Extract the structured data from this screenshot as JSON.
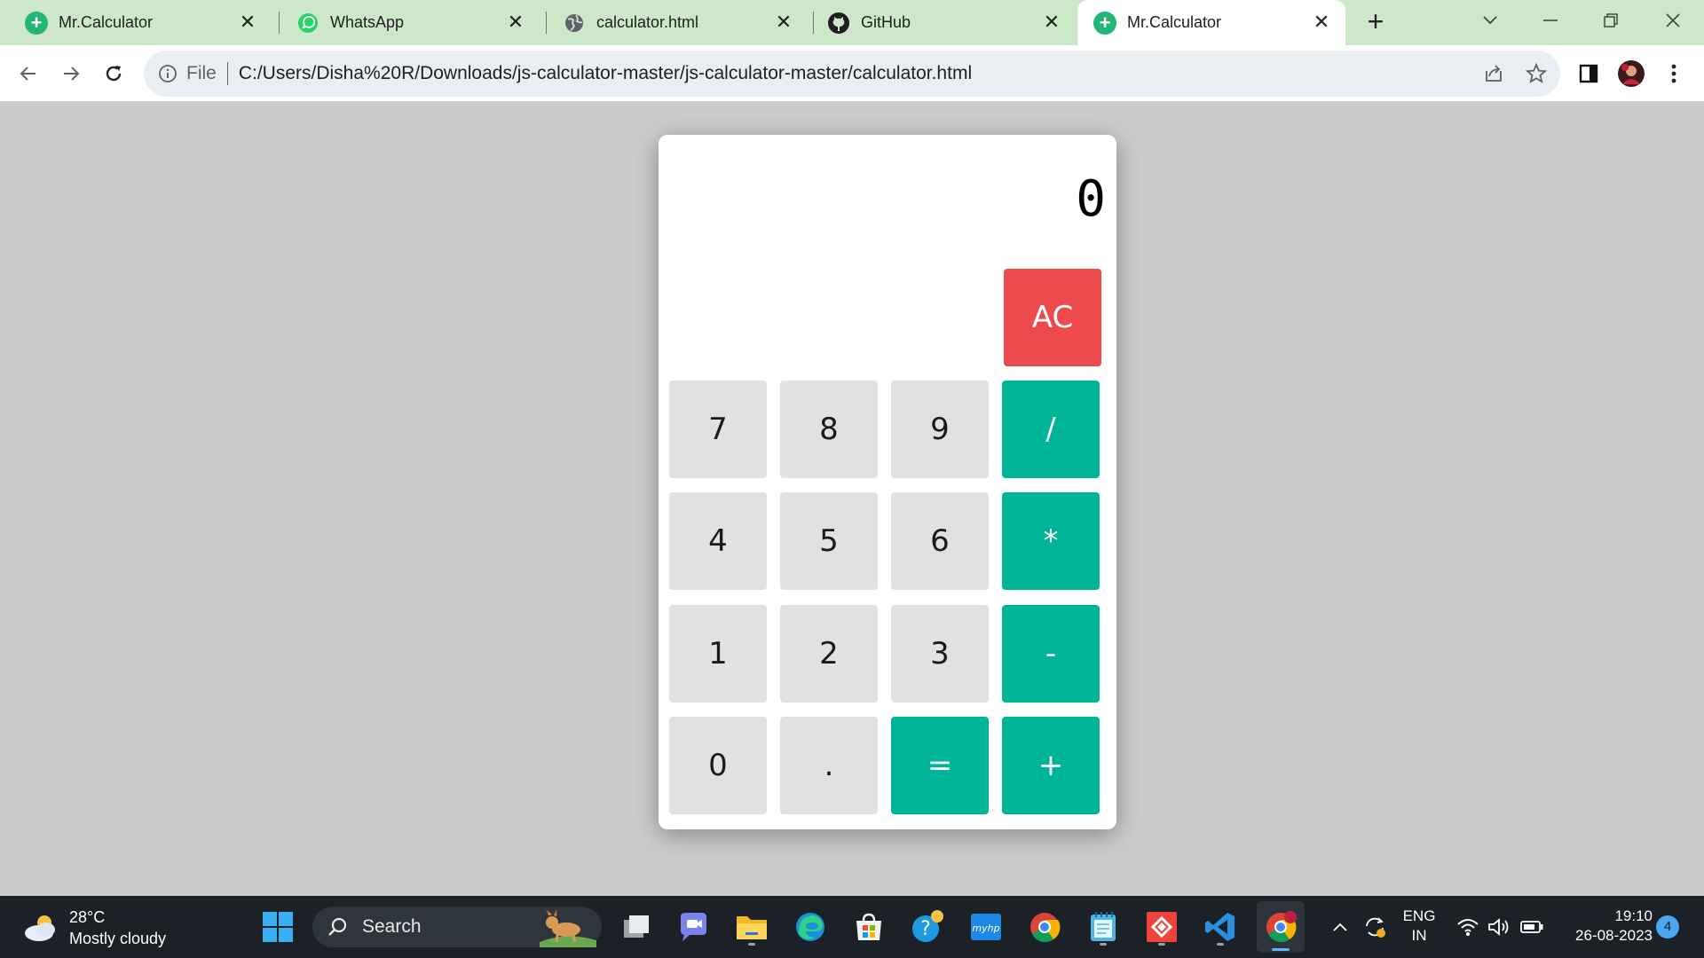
{
  "browser": {
    "tabs": [
      {
        "title": "Mr.Calculator",
        "icon": "plus-circle-icon"
      },
      {
        "title": "WhatsApp",
        "icon": "whatsapp-icon"
      },
      {
        "title": "calculator.html",
        "icon": "globe-icon"
      },
      {
        "title": "GitHub",
        "icon": "github-icon"
      },
      {
        "title": "Mr.Calculator",
        "icon": "plus-circle-icon",
        "active": true
      }
    ],
    "omnibox": {
      "scheme_label": "File",
      "url": "C:/Users/Disha%20R/Downloads/js-calculator-master/js-calculator-master/calculator.html"
    },
    "accent_color": "#cde8c8"
  },
  "calculator": {
    "display": "0",
    "clear_label": "AC",
    "keys": {
      "k7": "7",
      "k8": "8",
      "k9": "9",
      "div": "/",
      "k4": "4",
      "k5": "5",
      "k6": "6",
      "mul": "*",
      "k1": "1",
      "k2": "2",
      "k3": "3",
      "sub": "-",
      "k0": "0",
      "dot": ".",
      "eq": "=",
      "add": "+"
    },
    "colors": {
      "number_key": "#e1e1e1",
      "operator_key": "#00b597",
      "clear_key": "#ee4a4d"
    }
  },
  "taskbar": {
    "weather": {
      "temp": "28°C",
      "condition": "Mostly cloudy"
    },
    "search_label": "Search",
    "language": {
      "line1": "ENG",
      "line2": "IN"
    },
    "clock": {
      "time": "19:10",
      "date": "26-08-2023"
    },
    "notification_count": "4"
  }
}
